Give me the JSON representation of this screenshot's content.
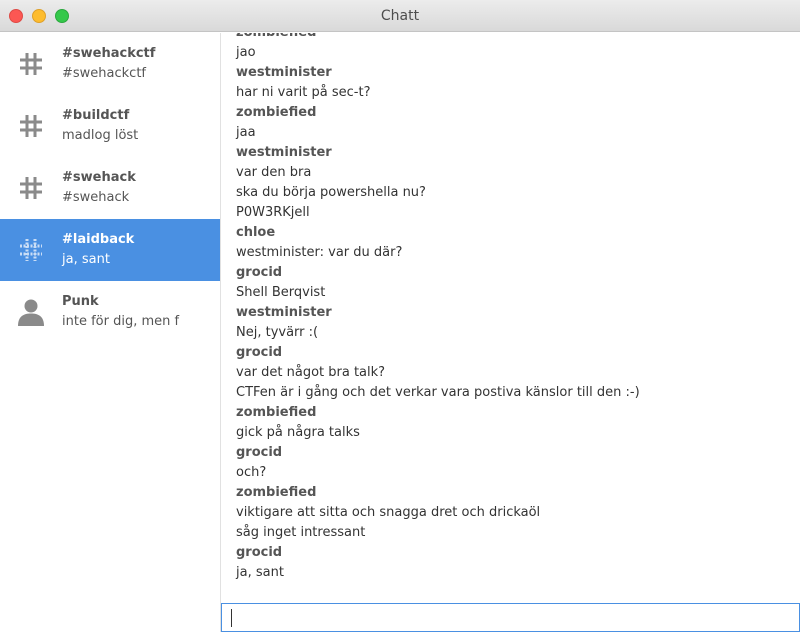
{
  "window": {
    "title": "Chatt"
  },
  "sidebar": {
    "items": [
      {
        "name": "#swehackctf",
        "last": "#swehackctf",
        "icon": "hash-icon",
        "selected": false
      },
      {
        "name": "#buildctf",
        "last": "madlog löst",
        "icon": "hash-icon",
        "selected": false
      },
      {
        "name": "#swehack",
        "last": "#swehack",
        "icon": "hash-icon",
        "selected": false
      },
      {
        "name": "#laidback",
        "last": "ja, sant",
        "icon": "hash-icon",
        "selected": true
      },
      {
        "name": "Punk",
        "last": "inte för dig, men f",
        "icon": "person-icon",
        "selected": false
      }
    ]
  },
  "messages": [
    {
      "author": "zombiefied",
      "lines": [
        "jao"
      ]
    },
    {
      "author": "westminister",
      "lines": [
        "har ni varit på sec-t?"
      ]
    },
    {
      "author": "zombiefied",
      "lines": [
        "jaa"
      ]
    },
    {
      "author": "westminister",
      "lines": [
        "var den bra",
        "ska du börja powershella nu?",
        "P0W3RKjell"
      ]
    },
    {
      "author": "chloe",
      "lines": [
        "westminister: var du där?"
      ]
    },
    {
      "author": "grocid",
      "lines": [
        "Shell Berqvist"
      ]
    },
    {
      "author": "westminister",
      "lines": [
        "Nej, tyvärr :("
      ]
    },
    {
      "author": "grocid",
      "lines": [
        "var det något bra talk?",
        "CTFen är i gång och det verkar vara postiva känslor till den :-)"
      ]
    },
    {
      "author": "zombiefied",
      "lines": [
        "gick på några talks"
      ]
    },
    {
      "author": "grocid",
      "lines": [
        "och?"
      ]
    },
    {
      "author": "zombiefied",
      "lines": [
        "viktigare att sitta och snagga dret och drickaöl",
        "såg inget intressant"
      ]
    },
    {
      "author": "grocid",
      "lines": [
        "ja, sant"
      ]
    }
  ],
  "composer": {
    "value": "",
    "placeholder": ""
  },
  "colors": {
    "accent": "#4a90e2",
    "close": "#fc5753",
    "minimize": "#fdbc2e",
    "maximize": "#34c84a"
  }
}
